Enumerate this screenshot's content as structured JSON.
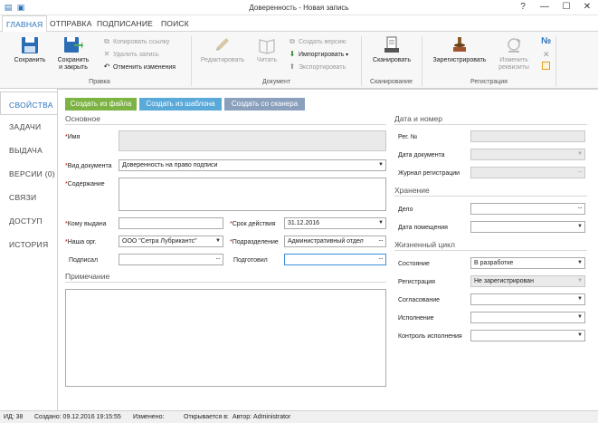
{
  "window": {
    "title": "Доверенность - Новая запись",
    "help": "?",
    "minimize": "—",
    "maximize": "☐",
    "close": "✕"
  },
  "ribbon_tabs": [
    "ГЛАВНАЯ",
    "ОТПРАВКА",
    "ПОДПИСАНИЕ",
    "ПОИСК"
  ],
  "ribbon": {
    "save": "Сохранить",
    "save_close_1": "Сохранить",
    "save_close_2": "и закрыть",
    "copy_link": "Копировать ссылку",
    "delete_record": "Удалить запись",
    "cancel_changes": "Отменить изменения",
    "group_edit": "Правка",
    "edit": "Редактировать",
    "read": "Читать",
    "create_version": "Создать версию",
    "import": "Импортировать",
    "export": "Экспортировать",
    "group_document": "Документ",
    "scan": "Сканировать",
    "group_scan": "Сканирование",
    "register": "Зарегистрировать",
    "change_req_1": "Изменить",
    "change_req_2": "реквизиты",
    "group_registration": "Регистрация",
    "numero": "№"
  },
  "nav": [
    "СВОЙСТВА",
    "ЗАДАЧИ",
    "ВЫДАЧА",
    "ВЕРСИИ (0)",
    "СВЯЗИ",
    "ДОСТУП",
    "ИСТОРИЯ"
  ],
  "create_buttons": [
    "Создать из файла",
    "Создать из шаблона",
    "Создать со сканера"
  ],
  "main": {
    "section_main": "Основное",
    "name_label": "Имя",
    "doctype_label": "Вид документа",
    "doctype_value": "Доверенность на право подписи",
    "content_label": "Содержание",
    "issued_to_label": "Кому выдана",
    "term_label": "Срок действия",
    "term_value": "31.12.2016",
    "our_org_label": "Наша орг.",
    "our_org_value": "ООО \"Сетра Лубрикантс\"",
    "department_label": "Подразделение",
    "department_value": "Административный отдел",
    "signed_label": "Подписал",
    "prepared_label": "Подготовил",
    "note_label": "Примечание",
    "required_mark": "*",
    "dots": "···"
  },
  "right": {
    "section_datenum": "Дата и номер",
    "reg_no_label": "Рег. №",
    "doc_date_label": "Дата документа",
    "journal_label": "Журнал регистрации",
    "section_storage": "Хранение",
    "case_label": "Дело",
    "placement_date_label": "Дата помещения",
    "section_lifecycle": "Жизненный цикл",
    "state_label": "Состояние",
    "state_value": "В разработке",
    "registration_label": "Регистрация",
    "registration_value": "Не зарегистрирован",
    "approval_label": "Согласование",
    "execution_label": "Исполнение",
    "control_label": "Контроль исполнения"
  },
  "status": {
    "id": "ИД: 38",
    "created": "Создано: 09.12.2016 19:15:55",
    "changed": "Изменено:",
    "opened_in": "Открывается в:",
    "author": "Автор: Administrator"
  },
  "colors": {
    "accent": "#2a72b8",
    "btn_file": "#7cb342",
    "btn_template": "#59a9d9",
    "btn_scanner": "#8aa0bd"
  }
}
